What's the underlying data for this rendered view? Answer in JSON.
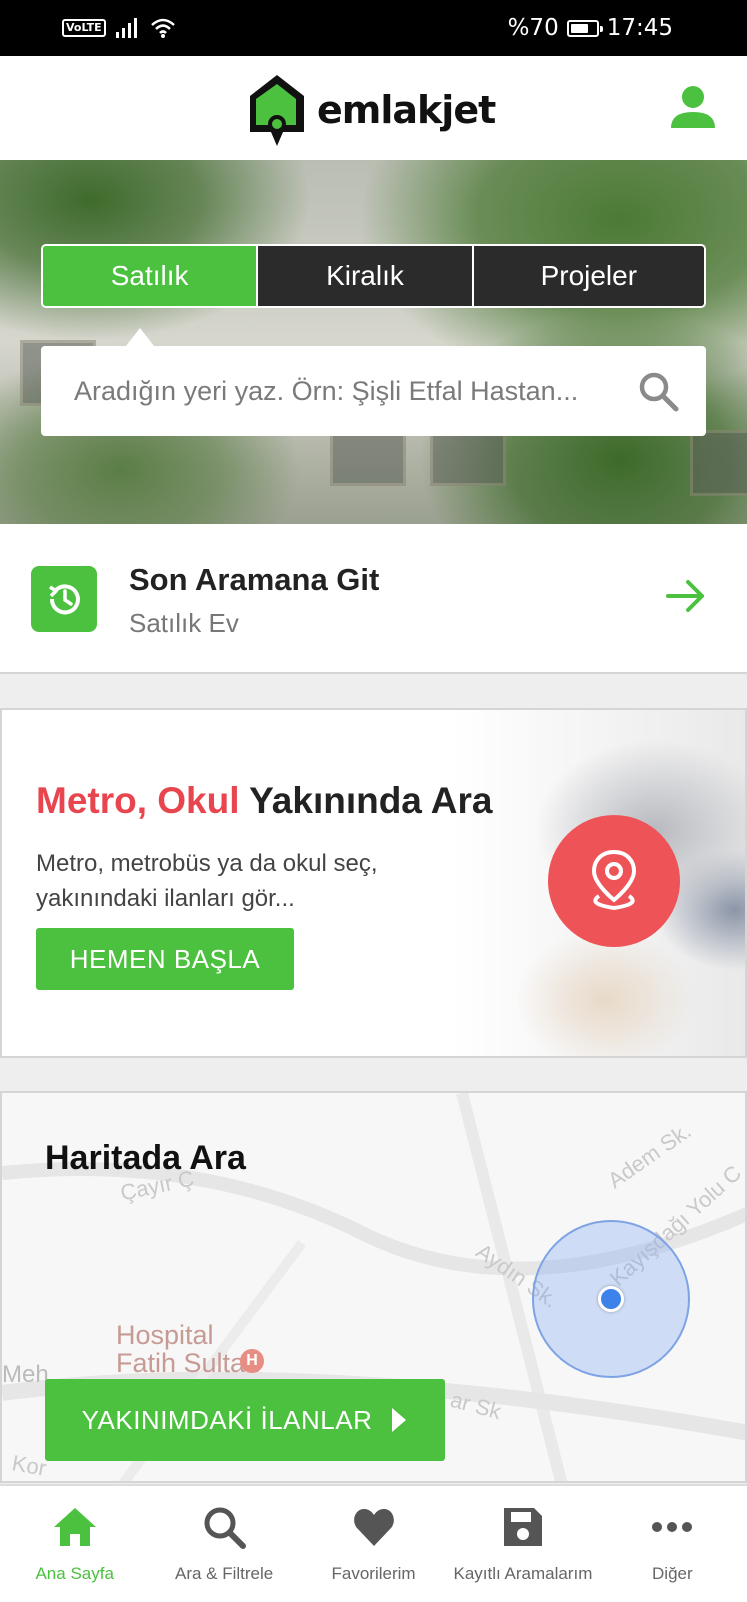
{
  "status_bar": {
    "network_label": "VoLTE",
    "battery_text": "%70",
    "battery_level": 0.7,
    "time": "17:45"
  },
  "header": {
    "logo_text": "emlakjet",
    "icons": [
      "house-logo-icon",
      "profile-icon"
    ]
  },
  "hero": {
    "tabs": [
      {
        "label": "Satılık",
        "active": true
      },
      {
        "label": "Kiralık",
        "active": false
      },
      {
        "label": "Projeler",
        "active": false
      }
    ],
    "search_placeholder": "Aradığın yeri yaz. Örn: Şişli Etfal Hastan..."
  },
  "last_search": {
    "title": "Son Aramana Git",
    "subtitle": "Satılık Ev"
  },
  "metro_card": {
    "title_highlight": "Metro, Okul",
    "title_rest": "Yakınında Ara",
    "description": "Metro, metrobüs ya da okul seç, yakınındaki ilanları gör...",
    "button_label": "HEMEN BAŞLA"
  },
  "map_card": {
    "title": "Haritada Ara",
    "streets": [
      "Çayır Ç",
      "Adem Sk.",
      "Kayışdağı Yolu C",
      "Aydın Sk.",
      "ar Sk",
      "Meh",
      "Kor"
    ],
    "hospital_label": "Hospital\nFatih Sultan",
    "hospital_badge": "H",
    "button_label": "YAKINIMDAKİ İLANLAR"
  },
  "bottom_nav": [
    {
      "label": "Ana Sayfa",
      "icon": "home-icon",
      "active": true
    },
    {
      "label": "Ara & Filtrele",
      "icon": "search-icon",
      "active": false
    },
    {
      "label": "Favorilerim",
      "icon": "heart-icon",
      "active": false
    },
    {
      "label": "Kayıtlı Aramalarım",
      "icon": "save-icon",
      "active": false
    },
    {
      "label": "Diğer",
      "icon": "more-icon",
      "active": false
    }
  ],
  "colors": {
    "brand_green": "#4cc13f",
    "accent_red": "#e8454f",
    "pin_red": "#ee5358",
    "location_blue": "#3d82ea"
  }
}
